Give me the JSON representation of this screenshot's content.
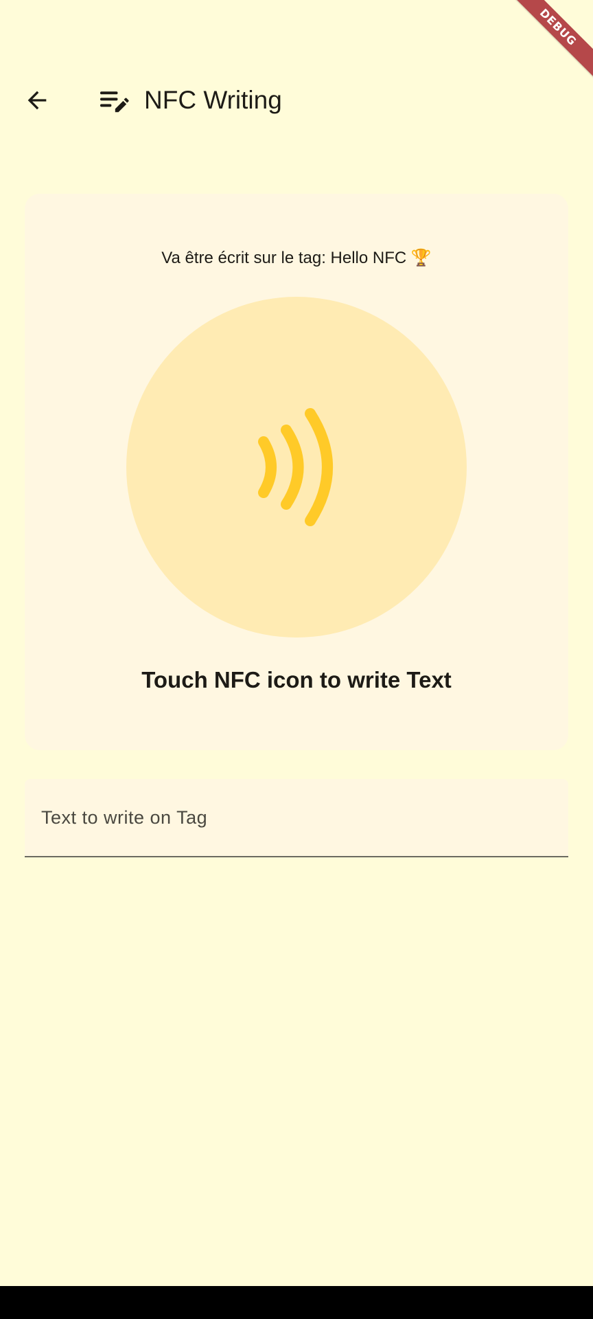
{
  "appbar": {
    "title": "NFC Writing",
    "back_icon": "arrow-back-icon",
    "title_icon": "edit-note-icon"
  },
  "debug_banner": {
    "label": "DEBUG"
  },
  "card": {
    "tag_line": "Va être écrit sur le tag: Hello NFC 🏆",
    "nfc_icon": "nfc-waves-icon",
    "touch_label": "Touch NFC icon to write Text"
  },
  "text_field": {
    "placeholder": "Text to write on Tag",
    "value": ""
  },
  "colors": {
    "background": "#FFFCD9",
    "card": "#FFF7E1",
    "circle": "#FFEBB3",
    "nfc_waves": "#FFCA28",
    "debug": "#B5484A"
  }
}
